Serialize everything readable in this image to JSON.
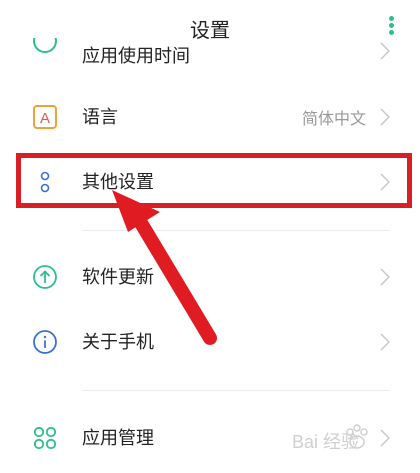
{
  "header": {
    "title": "设置",
    "more_icon": "more-vertical-icon",
    "accent": "#2bbf8a"
  },
  "rows": [
    {
      "name": "app-usage-time",
      "label": "应用使用时间",
      "icon": "clock-icon"
    },
    {
      "name": "language",
      "label": "语言",
      "value": "简体中文",
      "icon": "language-icon",
      "icon_color": "#f0a13a"
    },
    {
      "name": "other-settings",
      "label": "其他设置",
      "icon": "dots-icon",
      "icon_color": "#3b6fd6"
    },
    {
      "name": "software-update",
      "label": "软件更新",
      "icon": "update-arrow-icon",
      "icon_color": "#2bbf8a"
    },
    {
      "name": "about-phone",
      "label": "关于手机",
      "icon": "info-icon",
      "icon_color": "#3b6fd6"
    },
    {
      "name": "app-management",
      "label": "应用管理",
      "icon": "apps-icon",
      "icon_color": "#2bbf8a"
    }
  ],
  "annotation": {
    "highlight_color": "#d81f26"
  },
  "watermark": {
    "text": "Bai 经验"
  }
}
